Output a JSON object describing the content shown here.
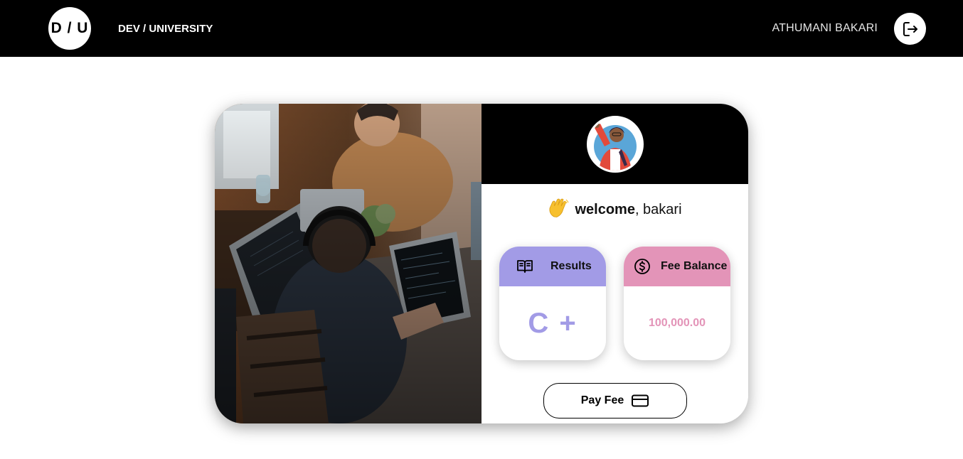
{
  "header": {
    "logo_text": "D / U",
    "brand": "DEV / UNIVERSITY",
    "user_name": "ATHUMANI BAKARI",
    "logout_icon": "logout-icon"
  },
  "welcome": {
    "emoji_icon": "waving-hand-icon",
    "greeting": "welcome",
    "name": ", bakari"
  },
  "results": {
    "label": "Results",
    "icon": "open-book-icon",
    "grade": "C +",
    "accent": "#a29be6"
  },
  "fee_balance": {
    "label": "Fee Balance",
    "icon": "dollar-circle-icon",
    "amount": "100,000.00",
    "accent": "#e394b8"
  },
  "pay_button": {
    "label": "Pay Fee",
    "icon": "credit-card-icon"
  },
  "photo": {
    "description_icon": "students-coding-photo"
  }
}
